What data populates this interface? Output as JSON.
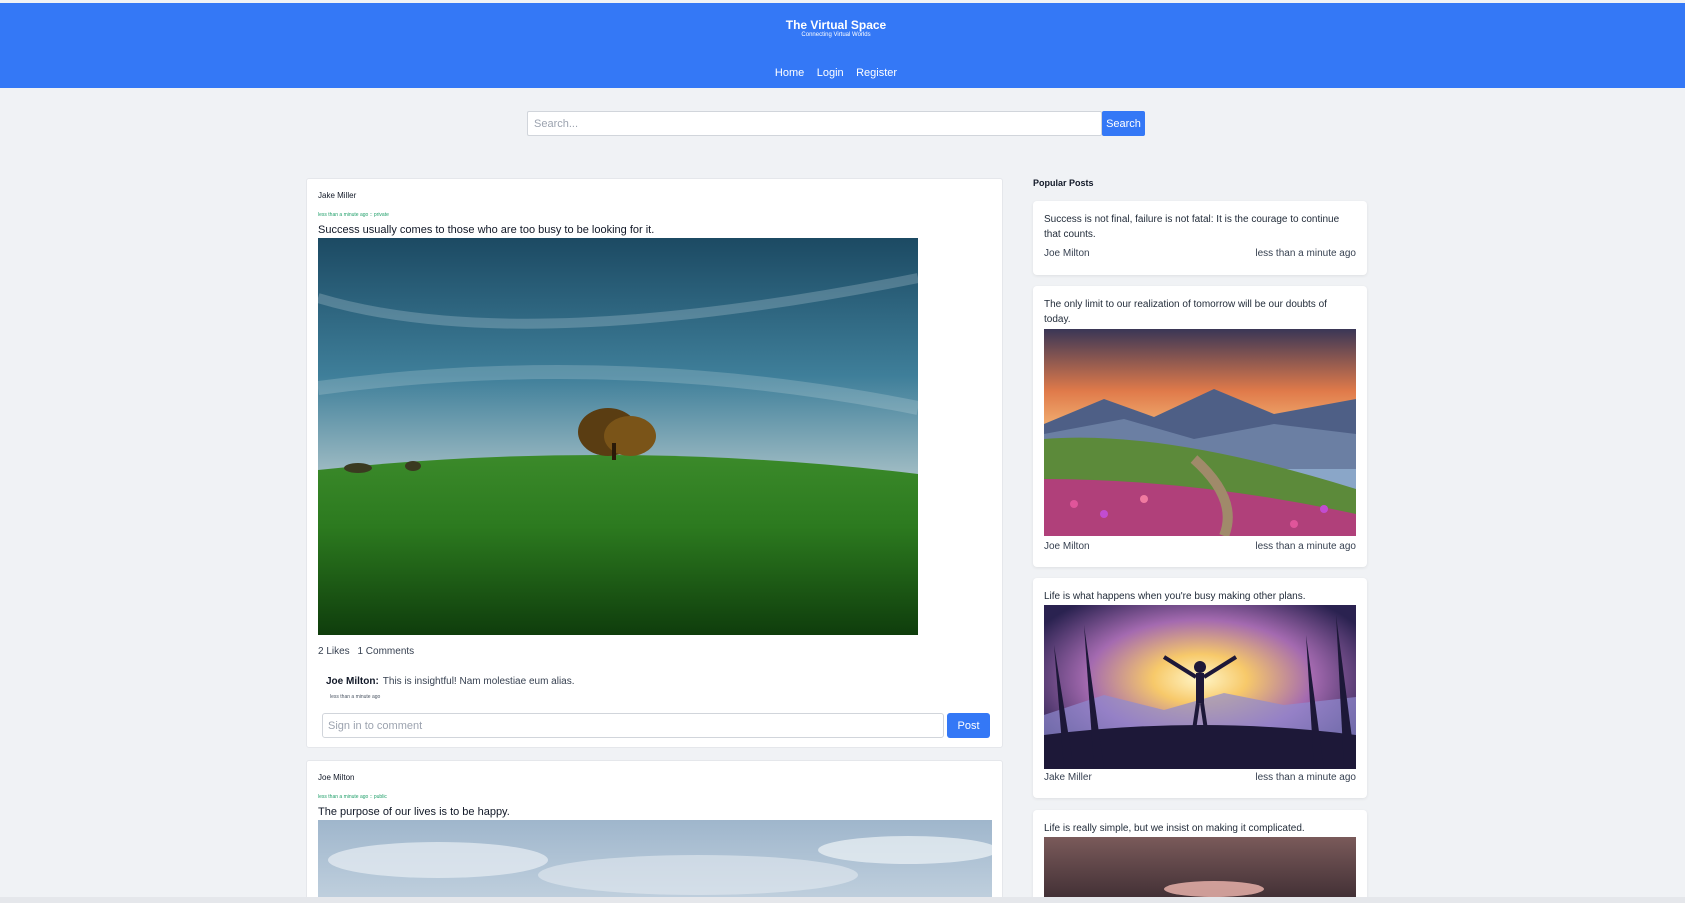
{
  "header": {
    "title": "The Virtual Space",
    "subtitle": "Connecting Virtual Worlds",
    "nav": [
      "Home",
      "Login",
      "Register"
    ]
  },
  "search": {
    "placeholder": "Search...",
    "button": "Search"
  },
  "feed": [
    {
      "author": "Jake Miller",
      "meta": "less than a minute ago :: private",
      "text": "Success usually comes to those who are too busy to be looking for it.",
      "likes": "2 Likes",
      "comments": "1 Comments",
      "comment": {
        "author": "Joe Milton:",
        "text": "This is insightful! Nam molestiae eum alias.",
        "time": "less than a minute ago"
      },
      "comment_placeholder": "Sign in to comment",
      "post_button": "Post"
    },
    {
      "author": "Joe Milton",
      "meta": "less than a minute ago :: public",
      "text": "The purpose of our lives is to be happy."
    }
  ],
  "popular": {
    "title": "Popular Posts",
    "items": [
      {
        "text": "Success is not final, failure is not fatal: It is the courage to continue that counts.",
        "author": "Joe Milton",
        "time": "less than a minute ago"
      },
      {
        "text": "The only limit to our realization of tomorrow will be our doubts of today.",
        "author": "Joe Milton",
        "time": "less than a minute ago"
      },
      {
        "text": "Life is what happens when you're busy making other plans.",
        "author": "Jake Miller",
        "time": "less than a minute ago"
      },
      {
        "text": "Life is really simple, but we insist on making it complicated."
      }
    ]
  },
  "colors": {
    "brand": "#3478f6",
    "meta_green": "#22a06b",
    "background": "#f0f2f5"
  }
}
